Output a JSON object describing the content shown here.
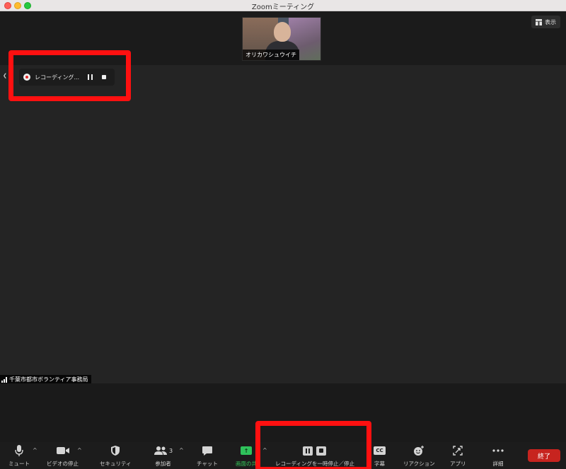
{
  "window": {
    "title": "Zoomミーティング"
  },
  "thumbnail": {
    "participant_name": "オリカワシュウイチ"
  },
  "view_button": {
    "label": "表示",
    "icon": "grid-view-icon"
  },
  "recording_indicator": {
    "label": "レコーディング...",
    "icon": "record-dot-icon"
  },
  "speaker": {
    "name": "千葉市都市ボランティア事務局"
  },
  "toolbar": {
    "mute": "ミュート",
    "video_stop": "ビデオの停止",
    "security": "セキュリティ",
    "participants": "参加者",
    "participants_count": "3",
    "chat": "チャット",
    "share_screen": "画面の共",
    "recording_control": "レコーディングを一時停止／停止",
    "captions": "字幕",
    "captions_icon_text": "CC",
    "reactions": "リアクション",
    "apps": "アプリ",
    "more": "詳細",
    "end": "終了"
  },
  "colors": {
    "end_button": "#c7241f",
    "share_green": "#35c759",
    "annotation_red": "#ff1010",
    "record_red": "#e02828"
  }
}
